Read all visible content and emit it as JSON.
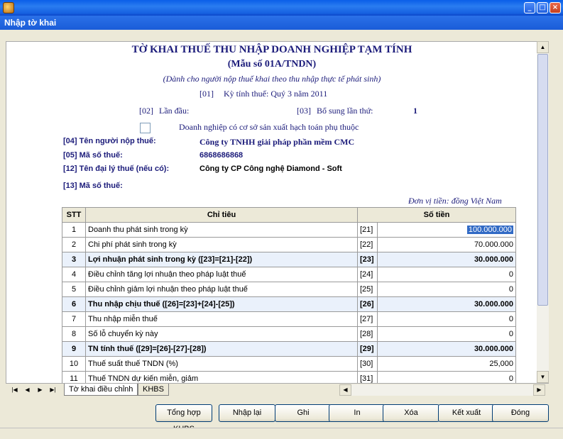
{
  "window": {
    "title": "Nhập tờ khai"
  },
  "form": {
    "title": "TỜ KHAI THUẾ THU NHẬP DOANH NGHIỆP TẠM TÍNH",
    "form_no": "(Mẫu số 01A/TNDN)",
    "subtitle": "(Dành cho người nộp thuế khai theo thu nhập thực tế phát sinh)",
    "period_code": "[01]",
    "period_label": "Kỳ tính thuế: Quý 3 năm 2011",
    "first_code": "[02]",
    "first_label": "Lần đầu:",
    "supp_code": "[03]",
    "supp_label": "Bổ sung lần thứ:",
    "supp_value": "1",
    "branch_label": "Doanh nghiệp có cơ sở sản xuất hạch toán phụ thuộc",
    "f04_label": "[04]  Tên người nộp thuế:",
    "f04_value": "Công ty TNHH giải pháp phần mềm CMC",
    "f05_label": "[05]  Mã số thuế:",
    "f05_value": "6868686868",
    "f12_label": "[12]  Tên đại lý thuế (nếu có):",
    "f12_value": "Công ty CP Công nghệ Diamond - Soft",
    "f13_label": "[13]  Mã số thuế:",
    "currency_note": "Đơn vị tiền: đồng Việt Nam"
  },
  "table": {
    "headers": [
      "STT",
      "Chỉ tiêu",
      "Số tiền"
    ],
    "rows": [
      {
        "stt": "1",
        "label": "Doanh thu phát sinh trong kỳ",
        "code": "[21]",
        "amount": "100.000.000"
      },
      {
        "stt": "2",
        "label": "Chi phí phát sinh trong kỳ",
        "code": "[22]",
        "amount": "70.000.000"
      },
      {
        "stt": "3",
        "label": "Lợi nhuận phát sinh trong kỳ ([23]=[21]-[22])",
        "code": "[23]",
        "amount": "30.000.000"
      },
      {
        "stt": "4",
        "label": "Điều chỉnh tăng lợi nhuận theo pháp luật thuế",
        "code": "[24]",
        "amount": "0"
      },
      {
        "stt": "5",
        "label": "Điều chỉnh giảm lợi nhuận theo pháp luật thuế",
        "code": "[25]",
        "amount": "0"
      },
      {
        "stt": "6",
        "label": "Thu nhập chịu thuế ([26]=[23]+[24]-[25])",
        "code": "[26]",
        "amount": "30.000.000"
      },
      {
        "stt": "7",
        "label": "Thu nhập miễn thuế",
        "code": "[27]",
        "amount": "0"
      },
      {
        "stt": "8",
        "label": "Số lỗ chuyển kỳ này",
        "code": "[28]",
        "amount": "0"
      },
      {
        "stt": "9",
        "label": "TN tính thuế ([29]=[26]-[27]-[28])",
        "code": "[29]",
        "amount": "30.000.000"
      },
      {
        "stt": "10",
        "label": "Thuế suất thuế TNDN (%)",
        "code": "[30]",
        "amount": "25,000"
      },
      {
        "stt": "11",
        "label": "Thuế TNDN dự kiến miễn, giảm",
        "code": "[31]",
        "amount": "0"
      }
    ]
  },
  "tabs": [
    "Tờ khai điều chỉnh",
    "KHBS"
  ],
  "buttons": {
    "summary": "Tổng hợp KHBS",
    "reenter": "Nhập lại",
    "save": "Ghi",
    "print": "In",
    "delete": "Xóa",
    "export": "Kết xuất",
    "close": "Đóng"
  },
  "icons": {
    "minimize": "minimize-icon",
    "maximize": "maximize-icon",
    "close": "close-icon",
    "app": "app-icon"
  }
}
